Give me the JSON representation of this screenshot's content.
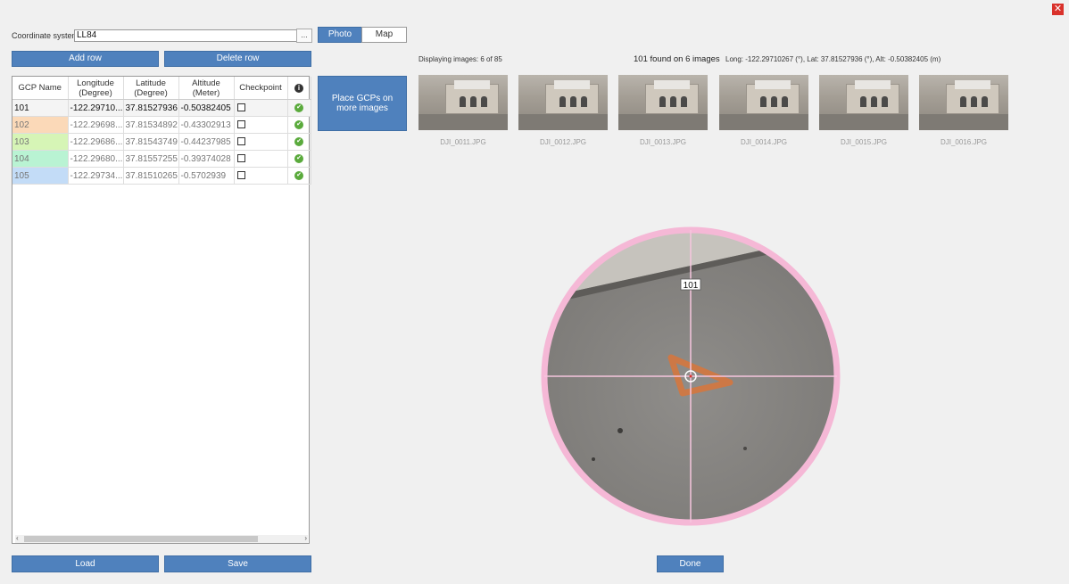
{
  "window": {
    "close_icon": "close-icon"
  },
  "coordinate_system": {
    "label": "Coordinate system:",
    "value": "LL84",
    "browse_label": "..."
  },
  "buttons": {
    "add_row": "Add row",
    "delete_row": "Delete row",
    "load": "Load",
    "save": "Save",
    "done": "Done",
    "place_gcps_line1": "Place GCPs on",
    "place_gcps_line2": "more images"
  },
  "view_toggle": {
    "photo": "Photo",
    "map": "Map",
    "active": "Photo"
  },
  "table": {
    "headers": [
      {
        "line1": "GCP Name",
        "line2": ""
      },
      {
        "line1": "Longitude",
        "line2": "(Degree)"
      },
      {
        "line1": "Latitude",
        "line2": "(Degree)"
      },
      {
        "line1": "Altitude",
        "line2": "(Meter)"
      },
      {
        "line1": "Checkpoint",
        "line2": ""
      }
    ],
    "rows": [
      {
        "name": "101",
        "lon": "-122.29710...",
        "lat": "37.81527936",
        "alt": "-0.50382405",
        "color": "#f4f4f4"
      },
      {
        "name": "102",
        "lon": "-122.29698...",
        "lat": "37.81534892",
        "alt": "-0.43302913",
        "color": "#fbd9b8"
      },
      {
        "name": "103",
        "lon": "-122.29686...",
        "lat": "37.81543749",
        "alt": "-0.44237985",
        "color": "#d6f5b6"
      },
      {
        "name": "104",
        "lon": "-122.29680...",
        "lat": "37.81557255",
        "alt": "-0.39374028",
        "color": "#b9f3d3"
      },
      {
        "name": "105",
        "lon": "-122.29734...",
        "lat": "37.81510265",
        "alt": "-0.5702939",
        "color": "#c3dcf7"
      }
    ]
  },
  "images": {
    "display_count": "Displaying images: 6 of 85",
    "found": "101 found on 6 images",
    "coords": "Long: -122.29710267 (°), Lat: 37.81527936 (°), Alt: -0.50382405 (m)",
    "thumbnails": [
      "DJI_0011.JPG",
      "DJI_0012.JPG",
      "DJI_0013.JPG",
      "DJI_0014.JPG",
      "DJI_0015.JPG",
      "DJI_0016.JPG"
    ]
  },
  "loupe": {
    "marker_label": "101",
    "ring_color": "#f5b8d6"
  },
  "colors": {
    "button": "#4f81bd",
    "check": "#5aaa3c",
    "close": "#d9312b"
  }
}
